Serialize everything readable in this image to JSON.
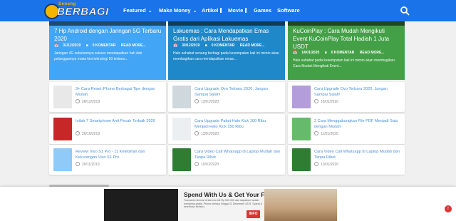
{
  "logo": {
    "small": "Senang",
    "big": "BERBAGI"
  },
  "nav": [
    {
      "label": "Featured",
      "dropdown": true
    },
    {
      "label": "Make Money",
      "dropdown": true
    },
    {
      "label": "Artikel",
      "dropdown": false
    },
    {
      "label": "Movie",
      "dropdown": false
    },
    {
      "label": "Games",
      "dropdown": false
    },
    {
      "label": "Software",
      "dropdown": false
    }
  ],
  "hero": [
    {
      "title": "7 Hp Android dengan Jaringan 5G Terbaru 2020",
      "date": "31/12/2019",
      "comments": "0 KOMENTAR",
      "more": "READ MORE...",
      "excerpt": "Jaringan 4G sebelumnya sukses mendapatkan hati dari pelanggannya maka kini teknologi 50 terbaru...",
      "color": "#42a5f5"
    },
    {
      "title": "Lakuemas : Cara Mendapatkan Emas Gratis dari Aplikasi Lakuemas",
      "date": "30/12/2019",
      "comments": "0 KOMENTAR",
      "more": "READ MORE...",
      "excerpt": "Halo sahabat senang berbagi pada kesempatan kali ini mimin akan membagikan cara mendapatkan emas...",
      "color": "#1e88c9"
    },
    {
      "title": "KuCoinPlay : Cara Mudah Mengikuti Event KuCoinPlay Total Hadiah 1 Juta USDT",
      "date": "14/01/2020",
      "comments": "0 KOMENTAR",
      "more": "READ MORE...",
      "excerpt": "Halo sahabat pada kesempatan kali ini mimin akan membagikan Cara Mudah Mengikuti Event...",
      "color": "#43a047"
    }
  ],
  "cards": [
    {
      "title": "3+ Cara Reset iPhone Berbagai Tipe dengan Mudah",
      "date": "28/12/2019",
      "thumb": "#e8e8e8"
    },
    {
      "title": "Cara Upgrade Ovo Terbaru 2020, Jangan Sampai Salah!",
      "date": "13/01/2020",
      "thumb": "#cfd8dc"
    },
    {
      "title": "Cara Upgrade Ovo Terbaru 2020, Jangan Sampai Salah!",
      "date": "13/01/2020",
      "thumb": "#b39ddb"
    },
    {
      "title": "Inilah 7 Smartphone Anti Pecah Terbaik 2020",
      "date": "26/10/2019",
      "thumb": "#c62828"
    },
    {
      "title": "Cara Upgrade Paket Halo Kick 100 Ribu Menjadi Halo Kick 150 Ribu",
      "date": "13/01/2020",
      "thumb": "#eceff1"
    },
    {
      "title": "2 Cara Menggabungkan File PDF Menjadi Satu dengan Mudah",
      "date": "11/01/2020",
      "thumb": "#66bb6a"
    },
    {
      "title": "Review Vivo S1 Pro - 11 Kelebihan dan Kekurangan Vivo S1 Pro",
      "date": "26/11/2019",
      "thumb": "#90caf9"
    },
    {
      "title": "Cara Video Call Whatsapp di Laptop Mudah dan Tanpa Ribet",
      "date": "10/01/2020",
      "thumb": "#2e7d32"
    },
    {
      "title": "Cara Video Call Whatsapp di Laptop Mudah dan Tanpa Ribet",
      "date": "10/01/2020",
      "thumb": "#2e7d32"
    }
  ],
  "ad": {
    "headline": "Spend With Us & Get Your Free Stay!",
    "subtext": "Transaksi minimal di kartu kredit Rp 500.000 dan dapatkan hadiah menginap gratis. Promo berlaku hingga 31 Desember 2019. Syarat & ketentuan berlaku.",
    "info": "INFO"
  },
  "notification": "!"
}
